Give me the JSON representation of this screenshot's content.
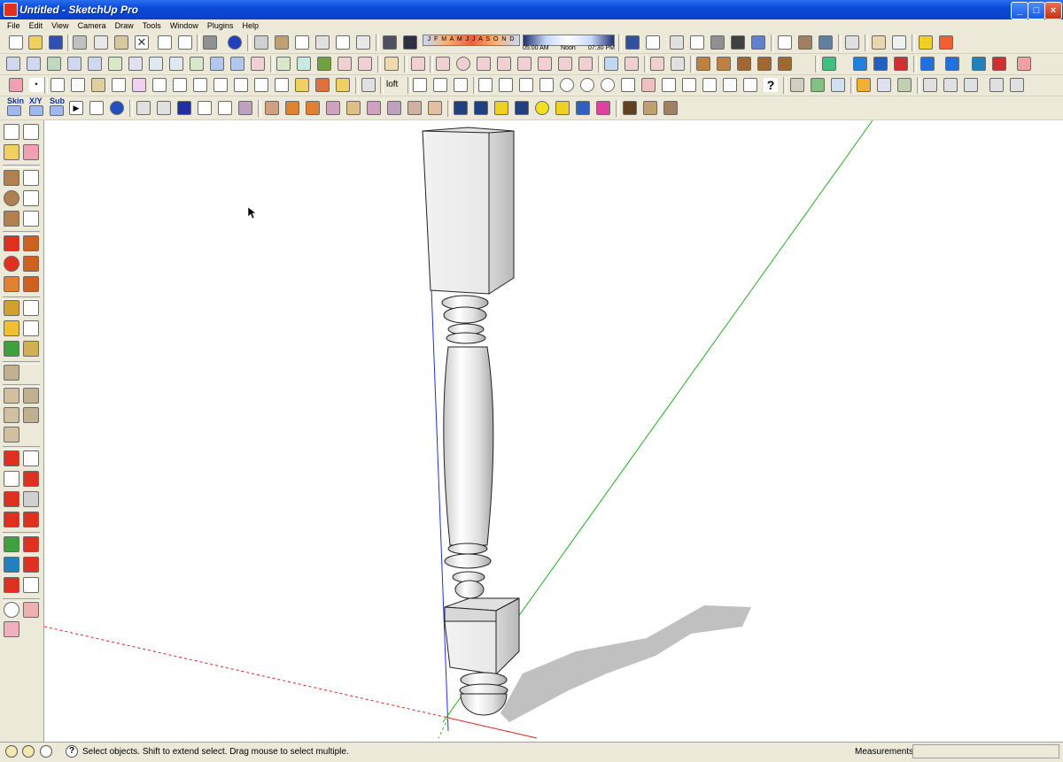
{
  "window": {
    "title": "Untitled - SketchUp Pro",
    "buttons": [
      "_",
      "□",
      "×"
    ]
  },
  "menu": [
    "File",
    "Edit",
    "View",
    "Camera",
    "Draw",
    "Tools",
    "Window",
    "Plugins",
    "Help"
  ],
  "shadow_settings": {
    "months": "J F M A M J J A S O N D",
    "time_start": "05:00 AM",
    "time_noon": "Noon",
    "time_end": "07:30 PM"
  },
  "toolbar_text": {
    "loft": "loft",
    "skin": "Skin",
    "xy": "X/Y",
    "sub": "Sub"
  },
  "statusbar": {
    "message": "Select objects. Shift to extend select. Drag mouse to select multiple.",
    "measurements_label": "Measurements",
    "measurements_value": ""
  },
  "colors": {
    "titlebar": "#0a4ad8",
    "chrome": "#ece9d8",
    "axis_red": "#e02020",
    "axis_green": "#20b020",
    "axis_blue": "#2030e0",
    "shadow": "#c0c0c0"
  }
}
